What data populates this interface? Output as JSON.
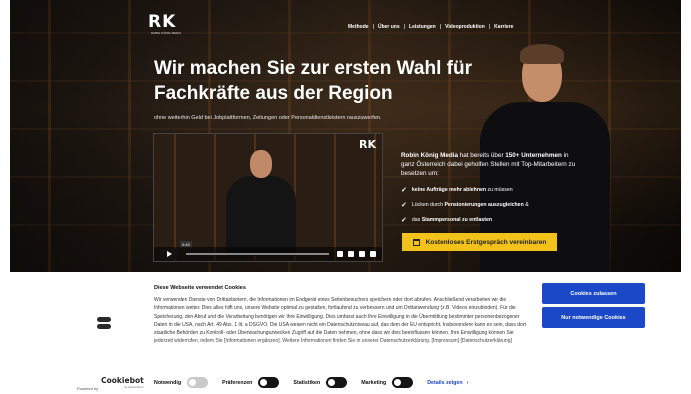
{
  "brand": {
    "logo": "RK",
    "tagline": "ROBIN KÖNIG MEDIA"
  },
  "nav": {
    "items": [
      "Methode",
      "Über uns",
      "Leistungen",
      "Videoproduktion",
      "Karriere"
    ],
    "separator": "|"
  },
  "hero": {
    "headline": "Wir machen Sie zur ersten Wahl für Fachkräfte aus der Region",
    "subline": "ohne weiterhin Geld bei Jobplattformen, Zeitungen oder Personaldienstleistern rauszuwerfen."
  },
  "video": {
    "logo": "RK",
    "time": "0:43",
    "icons": [
      "play-icon",
      "volume-icon",
      "settings-icon",
      "pip-icon",
      "fullscreen-icon"
    ]
  },
  "intro": {
    "part1": "Robin König Media",
    "part2": " hat bereits über ",
    "part3": "150+ Unternehmen",
    "part4": " in ganz Österreich dabei geholfen Stellen mit Top-Mitarbeitern zu besetzen um:"
  },
  "benefits": [
    {
      "bold": "keine Aufträge mehr ablehnen",
      "rest": " zu müssen"
    },
    {
      "pre": "Lücken durch ",
      "bold": "Pensionierungen auszugleichen",
      "rest": " &"
    },
    {
      "pre": "das ",
      "bold": "Stammpersonal zu entlasten",
      "rest": ""
    }
  ],
  "cta": {
    "label": "Kostenloses Erstgespräch vereinbaren",
    "color": "#f2c21a"
  },
  "cookie": {
    "title": "Diese Webseite verwendet Cookies",
    "text": "Wir verwenden Dienste von Drittanbietern, die Informationen im Endgerät eines Seitenbesuchers speichern oder dort abrufen. Anschließend verarbeiten wir die Informationen weiter. Dies alles hilft uns, unsere Website optimal zu gestalten, fortlaufend zu verbessern und um Drittanwendung (z.B. Videos einzubinden). Für die Speicherung, den Abruf und die Verarbeitung benötigen wir Ihre Einwilligung. Dies umfasst auch Ihre Einwilligung in die Übermittlung bestimmter personenbezogener Daten in die USA, nach Art. 49 Abs. 1 lit. a DSGVO. Die USA weisen nicht ein Datenschutzniveau auf, das dem der EU entspricht. Insbesondere kann es sein, dass dort staatliche Behörden zu Kontroll- oder Überwachungszwecken Zugriff auf die Daten nehmen, ohne dass wir dies beeinflussen können. Ihre Einwilligung können Sie jederzeit widerrufen, indem Sie [Informationen ergänzen]. Weitere Informationen finden Sie in unserer Datenschutzerklärung. [Impressum] [Datenschutzerklärung]",
    "accept_all": "Cookies zulassen",
    "necessary_only": "Nur notwendige Cookies",
    "powered_by": "Powered by",
    "cookiebot": "Cookiebot",
    "cookiebot_sub": "by Usercentrics",
    "toggles": [
      {
        "label": "Notwendig",
        "on": true,
        "disabled": true
      },
      {
        "label": "Präferenzen",
        "on": false,
        "disabled": false
      },
      {
        "label": "Statistiken",
        "on": false,
        "disabled": false
      },
      {
        "label": "Marketing",
        "on": false,
        "disabled": false
      }
    ],
    "details": "Details zeigen",
    "accent": "#1a48c7"
  }
}
